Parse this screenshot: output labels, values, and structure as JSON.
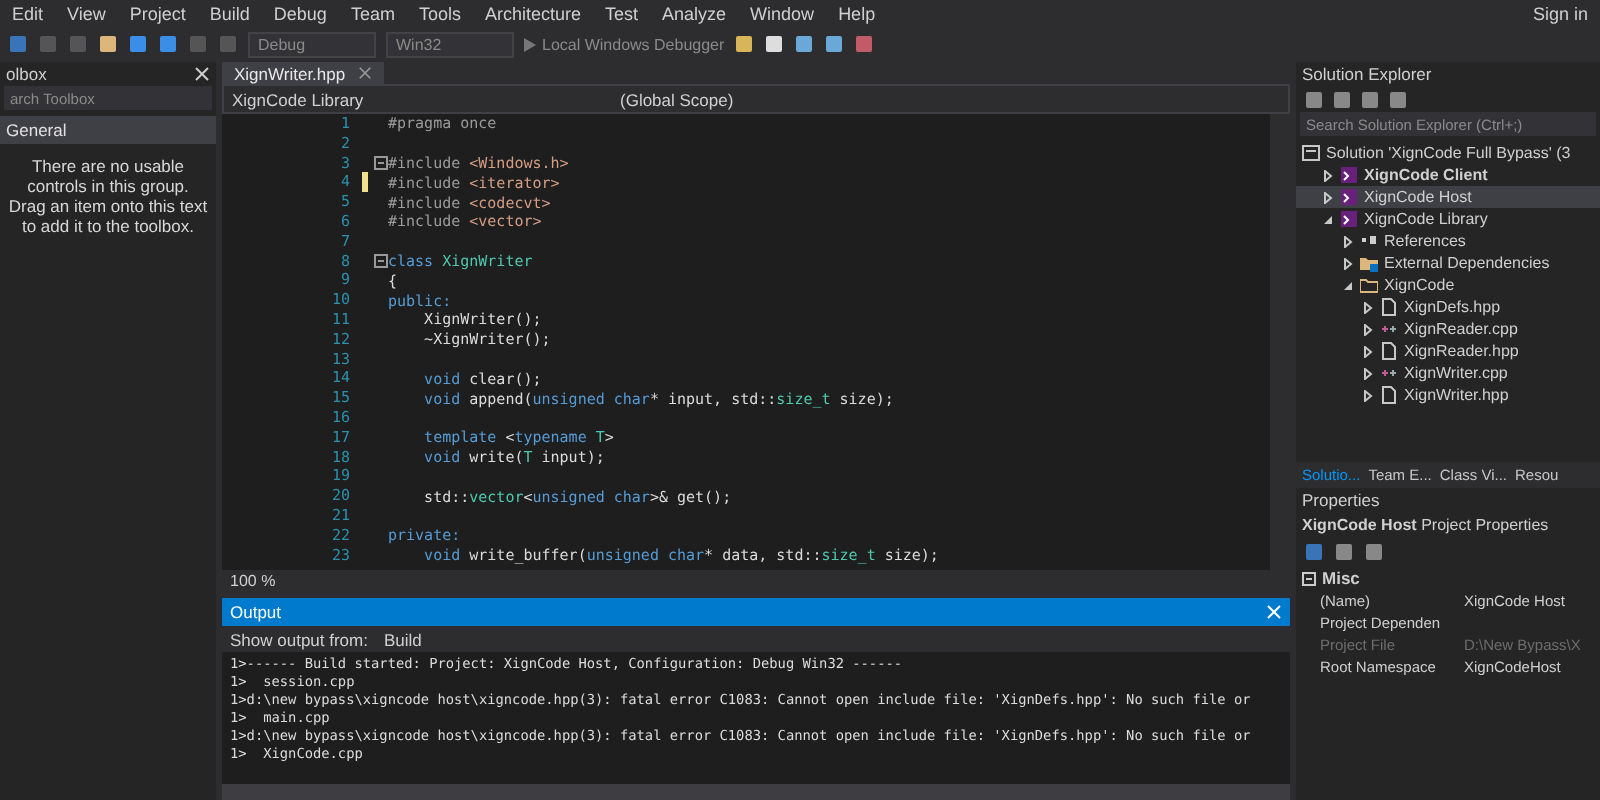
{
  "menu": [
    "Edit",
    "View",
    "Project",
    "Build",
    "Debug",
    "Team",
    "Tools",
    "Architecture",
    "Test",
    "Analyze",
    "Window",
    "Help"
  ],
  "account": "Sign in",
  "toolbar": {
    "configuration": "Debug",
    "platform": "Win32",
    "run": "Local Windows Debugger"
  },
  "toolbox": {
    "title": "olbox",
    "search": {
      "placeholder": "arch Toolbox"
    },
    "group": "General",
    "message": "There are no usable controls in this group. Drag an item onto this text to add it to the toolbox."
  },
  "editor": {
    "tab": "XignWriter.hpp",
    "project": "XignCode Library",
    "scope": "(Global Scope)",
    "zoom": "100 %",
    "lines": [
      {
        "number": "1",
        "fold": false,
        "modified": false,
        "tokens": [
          {
            "kind": "pp",
            "text": "#pragma once"
          }
        ]
      },
      {
        "number": "2",
        "fold": false,
        "modified": false
      },
      {
        "number": "3",
        "fold": true,
        "modified": false,
        "tokens": [
          {
            "kind": "pp",
            "text": "#include "
          },
          {
            "kind": "inc",
            "text": "<Windows.h>"
          }
        ]
      },
      {
        "number": "4",
        "fold": false,
        "modified": true,
        "tokens": [
          {
            "kind": "pp",
            "text": "#include "
          },
          {
            "kind": "inc",
            "text": "<iterator>"
          }
        ]
      },
      {
        "number": "5",
        "fold": false,
        "modified": false,
        "tokens": [
          {
            "kind": "pp",
            "text": "#include "
          },
          {
            "kind": "inc",
            "text": "<codecvt>"
          }
        ]
      },
      {
        "number": "6",
        "fold": false,
        "modified": false,
        "tokens": [
          {
            "kind": "pp",
            "text": "#include "
          },
          {
            "kind": "inc",
            "text": "<vector>"
          }
        ]
      },
      {
        "number": "7",
        "fold": false,
        "modified": false
      },
      {
        "number": "8",
        "fold": true,
        "modified": false,
        "tokens": [
          {
            "kind": "kw",
            "text": "class "
          },
          {
            "kind": "cls",
            "text": "XignWriter"
          }
        ]
      },
      {
        "number": "9",
        "fold": false,
        "modified": false,
        "tokens": [
          {
            "kind": "txt",
            "text": "{"
          }
        ]
      },
      {
        "number": "10",
        "fold": false,
        "modified": false,
        "tokens": [
          {
            "kind": "kw",
            "text": "public:"
          }
        ]
      },
      {
        "number": "11",
        "fold": false,
        "modified": false,
        "tokens": [
          {
            "kind": "txt",
            "text": "    XignWriter();"
          }
        ]
      },
      {
        "number": "12",
        "fold": false,
        "modified": false,
        "tokens": [
          {
            "kind": "txt",
            "text": "    ~XignWriter();"
          }
        ]
      },
      {
        "number": "13",
        "fold": false,
        "modified": false
      },
      {
        "number": "14",
        "fold": false,
        "modified": false,
        "tokens": [
          {
            "kind": "kw",
            "text": "    void "
          },
          {
            "kind": "txt",
            "text": "clear();"
          }
        ]
      },
      {
        "number": "15",
        "fold": false,
        "modified": false,
        "tokens": [
          {
            "kind": "kw",
            "text": "    void "
          },
          {
            "kind": "txt",
            "text": "append("
          },
          {
            "kind": "kw",
            "text": "unsigned char"
          },
          {
            "kind": "txt",
            "text": "* input, std::"
          },
          {
            "kind": "cls",
            "text": "size_t"
          },
          {
            "kind": "txt",
            "text": " size);"
          }
        ]
      },
      {
        "number": "16",
        "fold": false,
        "modified": false
      },
      {
        "number": "17",
        "fold": false,
        "modified": false,
        "tokens": [
          {
            "kind": "kw",
            "text": "    template "
          },
          {
            "kind": "txt",
            "text": "<"
          },
          {
            "kind": "kw",
            "text": "typename"
          },
          {
            "kind": "cls",
            "text": " T"
          },
          {
            "kind": "txt",
            "text": ">"
          }
        ]
      },
      {
        "number": "18",
        "fold": false,
        "modified": false,
        "tokens": [
          {
            "kind": "kw",
            "text": "    void "
          },
          {
            "kind": "txt",
            "text": "write("
          },
          {
            "kind": "cls",
            "text": "T"
          },
          {
            "kind": "txt",
            "text": " input);"
          }
        ]
      },
      {
        "number": "19",
        "fold": false,
        "modified": false
      },
      {
        "number": "20",
        "fold": false,
        "modified": false,
        "tokens": [
          {
            "kind": "txt",
            "text": "    std::"
          },
          {
            "kind": "cls",
            "text": "vector"
          },
          {
            "kind": "txt",
            "text": "<"
          },
          {
            "kind": "kw",
            "text": "unsigned char"
          },
          {
            "kind": "txt",
            "text": ">& get();"
          }
        ]
      },
      {
        "number": "21",
        "fold": false,
        "modified": false
      },
      {
        "number": "22",
        "fold": false,
        "modified": false,
        "tokens": [
          {
            "kind": "kw",
            "text": "private:"
          }
        ]
      },
      {
        "number": "23",
        "fold": false,
        "modified": false,
        "tokens": [
          {
            "kind": "kw",
            "text": "    void "
          },
          {
            "kind": "txt",
            "text": "write_buffer("
          },
          {
            "kind": "kw",
            "text": "unsigned char"
          },
          {
            "kind": "txt",
            "text": "* data, std::"
          },
          {
            "kind": "cls",
            "text": "size_t"
          },
          {
            "kind": "txt",
            "text": " size);"
          }
        ]
      }
    ]
  },
  "output": {
    "title": "Output",
    "source_label": "Show output from:",
    "source": "Build",
    "lines": [
      "1>------ Build started: Project: XignCode Host, Configuration: Debug Win32 ------",
      "1>  session.cpp",
      "1>d:\\new bypass\\xigncode host\\xigncode.hpp(3): fatal error C1083: Cannot open include file: 'XignDefs.hpp': No such file or",
      "1>  main.cpp",
      "1>d:\\new bypass\\xigncode host\\xigncode.hpp(3): fatal error C1083: Cannot open include file: 'XignDefs.hpp': No such file or",
      "1>  XignCode.cpp"
    ]
  },
  "solution_explorer": {
    "title": "Solution Explorer",
    "search": {
      "placeholder": "Search Solution Explorer (Ctrl+;)"
    },
    "tree": [
      {
        "label": "Solution 'XignCode Full Bypass' (3",
        "kind": "solution",
        "selected": false,
        "bold": false,
        "children": [
          {
            "label": "XignCode Client",
            "kind": "project",
            "expanded": false,
            "selected": false,
            "bold": true
          },
          {
            "label": "XignCode Host",
            "kind": "project",
            "expanded": false,
            "selected": true,
            "bold": false
          },
          {
            "label": "XignCode Library",
            "kind": "project",
            "expanded": true,
            "selected": false,
            "bold": false,
            "children": [
              {
                "label": "References",
                "kind": "references",
                "expanded": false,
                "selected": false,
                "bold": false
              },
              {
                "label": "External Dependencies",
                "kind": "dependencies",
                "expanded": false,
                "selected": false,
                "bold": false
              },
              {
                "label": "XignCode",
                "kind": "folder",
                "expanded": true,
                "selected": false,
                "bold": false,
                "children": [
                  {
                    "label": "XignDefs.hpp",
                    "kind": "header",
                    "expanded": false,
                    "selected": false,
                    "bold": false
                  },
                  {
                    "label": "XignReader.cpp",
                    "kind": "source",
                    "expanded": false,
                    "selected": false,
                    "bold": false
                  },
                  {
                    "label": "XignReader.hpp",
                    "kind": "header",
                    "expanded": false,
                    "selected": false,
                    "bold": false
                  },
                  {
                    "label": "XignWriter.cpp",
                    "kind": "source",
                    "expanded": false,
                    "selected": false,
                    "bold": false
                  },
                  {
                    "label": "XignWriter.hpp",
                    "kind": "header",
                    "expanded": false,
                    "selected": false,
                    "bold": false
                  }
                ]
              }
            ]
          }
        ]
      }
    ],
    "tabs": [
      {
        "label": "Solutio...",
        "selected": true
      },
      {
        "label": "Team E...",
        "selected": false
      },
      {
        "label": "Class Vi...",
        "selected": false
      },
      {
        "label": "Resou",
        "selected": false
      }
    ]
  },
  "properties": {
    "title": "Properties",
    "object": "**XignCode Host** Project Properties",
    "category": "Misc",
    "rows": [
      {
        "name": "(Name)",
        "value": "XignCode Host",
        "disabled": false
      },
      {
        "name": "Project Dependen",
        "disabled": false
      },
      {
        "name": "Project File",
        "value": "D:\\New Bypass\\X",
        "disabled": true
      },
      {
        "name": "Root Namespace",
        "value": "XignCodeHost",
        "disabled": false
      }
    ]
  }
}
